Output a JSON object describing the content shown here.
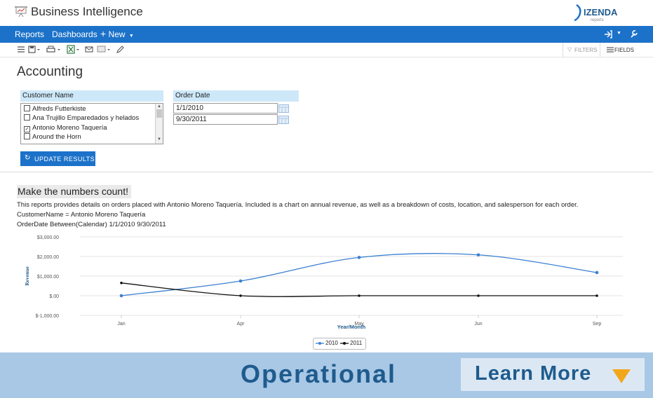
{
  "app": {
    "title": "Business Intelligence",
    "logo_text": "IZENDA",
    "logo_sub": "reports"
  },
  "nav": {
    "reports": "Reports",
    "dashboards": "Dashboards",
    "new": "New"
  },
  "toolbar": {
    "filters_label": "FILTERS",
    "fields_label": "FIELDS",
    "icons": [
      "list-icon",
      "save-icon",
      "print-icon",
      "excel-icon",
      "email-icon",
      "results-count-icon",
      "edit-icon"
    ]
  },
  "report": {
    "title": "Accounting",
    "customer_filter": {
      "label": "Customer Name",
      "items": [
        {
          "label": "Alfreds Futterkiste",
          "checked": false
        },
        {
          "label": "Ana Trujillo Emparedados y helados",
          "checked": false
        },
        {
          "label": "Antonio Moreno Taquería",
          "checked": true
        },
        {
          "label": "Around the Horn",
          "checked": false
        }
      ]
    },
    "date_filter": {
      "label": "Order Date",
      "from": "1/1/2010",
      "to": "9/30/2011"
    },
    "update_button": "UPDATE RESULTS",
    "description": {
      "title": "Make the numbers count!",
      "line1": "This reports provides details on orders placed with Antonio Moreno Taquería. Included is a chart on annual revenue, as well as a breakdown of costs, location, and salesperson for each order.",
      "line2": "CustomerName = Antonio Moreno Taquería",
      "line3": "OrderDate Between(Calendar) 1/1/2010 9/30/2011"
    }
  },
  "chart_data": {
    "type": "line",
    "categories": [
      "Jan",
      "Apr",
      "May",
      "Jun",
      "Sep"
    ],
    "series": [
      {
        "name": "2010",
        "values": [
          0,
          750,
          1950,
          2080,
          1180
        ],
        "color": "#3a80d0"
      },
      {
        "name": "2011",
        "values": [
          650,
          0,
          0,
          0,
          0
        ],
        "color": "#111111"
      }
    ],
    "xlabel": "Year/Month",
    "ylabel": "Revenue",
    "ylim": [
      -1000,
      3000
    ],
    "yticks": [
      "$3,000.00",
      "$2,000.00",
      "$1,000.00",
      "$.00",
      "$-1,000.00"
    ],
    "ytick_values": [
      3000,
      2000,
      1000,
      0,
      -1000
    ],
    "grid": true,
    "legend": "bottom"
  },
  "banner": {
    "text": "Operational",
    "button": "Learn More",
    "color": "#1f5b8d"
  }
}
